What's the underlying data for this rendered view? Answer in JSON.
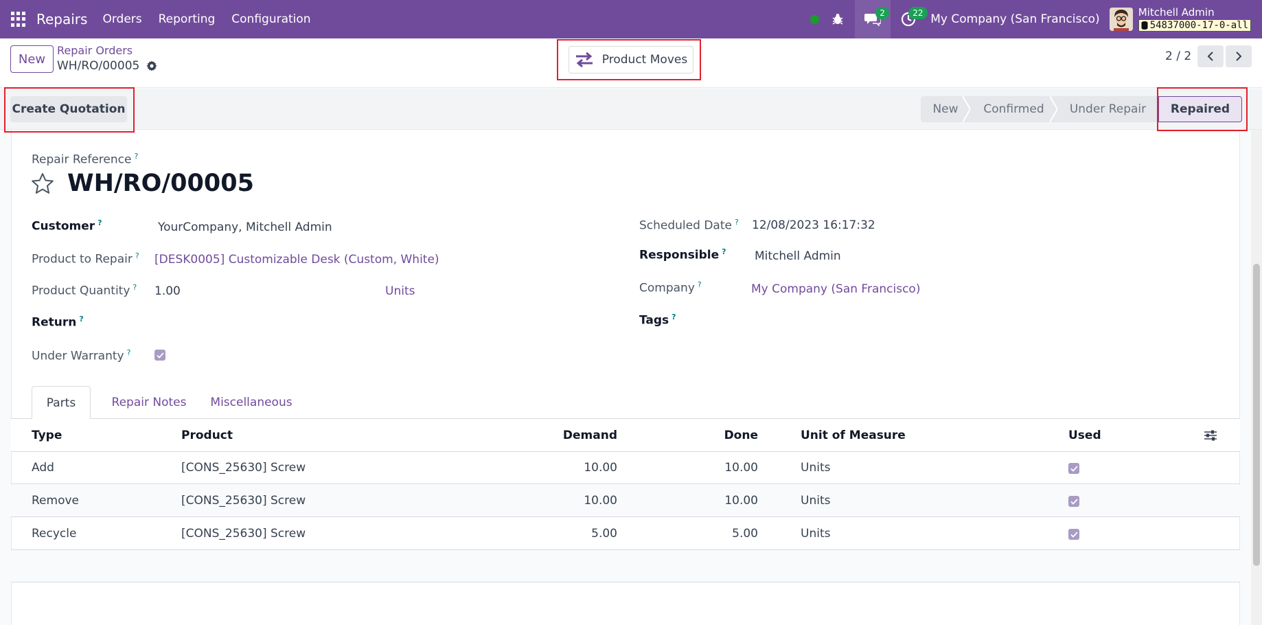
{
  "navbar": {
    "app_name": "Repairs",
    "menus": [
      "Orders",
      "Reporting",
      "Configuration"
    ],
    "chat_count": "2",
    "activity_count": "22",
    "company": "My Company (San Francisco)",
    "user_name": "Mitchell Admin",
    "database": "54837000-17-0-all"
  },
  "control": {
    "new_label": "New",
    "breadcrumb_parent": "Repair Orders",
    "breadcrumb_current": "WH/RO/00005",
    "product_moves_label": "Product Moves",
    "pager": "2 / 2"
  },
  "statusbar": {
    "create_quotation_label": "Create Quotation",
    "stages": [
      "New",
      "Confirmed",
      "Under Repair",
      "Repaired"
    ],
    "active_stage": "Repaired"
  },
  "form": {
    "reference_label": "Repair Reference",
    "reference": "WH/RO/00005",
    "help_mark": "?",
    "left": {
      "customer_label": "Customer",
      "customer": "YourCompany, Mitchell Admin",
      "product_label": "Product to Repair",
      "product": "[DESK0005] Customizable Desk (Custom, White)",
      "quantity_label": "Product Quantity",
      "quantity": "1.00",
      "quantity_uom": "Units",
      "return_label": "Return",
      "warranty_label": "Under Warranty",
      "warranty_checked": true
    },
    "right": {
      "scheduled_label": "Scheduled Date",
      "scheduled": "12/08/2023 16:17:32",
      "responsible_label": "Responsible",
      "responsible": "Mitchell Admin",
      "company_label": "Company",
      "company": "My Company (San Francisco)",
      "tags_label": "Tags"
    }
  },
  "tabs": [
    "Parts",
    "Repair Notes",
    "Miscellaneous"
  ],
  "parts_table": {
    "headers": {
      "type": "Type",
      "product": "Product",
      "demand": "Demand",
      "done": "Done",
      "uom": "Unit of Measure",
      "used": "Used"
    },
    "rows": [
      {
        "type": "Add",
        "product": "[CONS_25630] Screw",
        "demand": "10.00",
        "done": "10.00",
        "uom": "Units",
        "used": true
      },
      {
        "type": "Remove",
        "product": "[CONS_25630] Screw",
        "demand": "10.00",
        "done": "10.00",
        "uom": "Units",
        "used": true
      },
      {
        "type": "Recycle",
        "product": "[CONS_25630] Screw",
        "demand": "5.00",
        "done": "5.00",
        "uom": "Units",
        "used": true
      }
    ]
  },
  "colors": {
    "brand": "#714b9b",
    "highlight": "#e41e2c",
    "badge": "#1aa154"
  }
}
